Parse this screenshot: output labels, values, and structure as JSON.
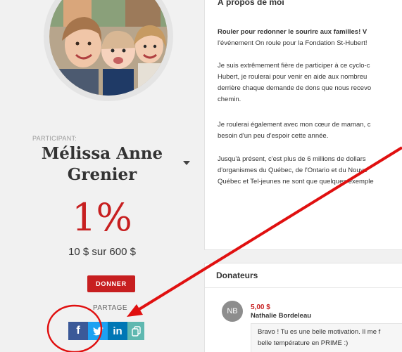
{
  "profile": {
    "participant_label": "PARTICIPANT:",
    "name": "Mélissa Anne Grenier",
    "percent": "1%",
    "amount": "10 $ sur 600 $",
    "donate_label": "DONNER",
    "share_label": "PARTAGE",
    "share_icons": [
      "facebook-icon",
      "twitter-icon",
      "linkedin-icon",
      "copy-icon"
    ],
    "share_glyphs": {
      "facebook": "f",
      "linkedin": "in"
    }
  },
  "about": {
    "title": "À propos de moi",
    "paragraphs": [
      [
        "Rouler pour redonner le sourire aux familles! V",
        "l'événement On roule pour la Fondation St-Hubert!"
      ],
      [
        "Je suis extrêmement fière de participer à ce cyclo-c",
        "Hubert, je roulerai pour venir en aide aux nombreu",
        "derrière chaque demande de dons que nous recevo",
        "chemin."
      ],
      [
        "Je roulerai également avec mon cœur de maman, c",
        "besoin d'un peu d'espoir cette année."
      ],
      [
        "Jusqu'à présent, c'est plus de 6 millions de dollars",
        "d'organismes du Québec, de l'Ontario et du Nouve",
        "Québec et Tel-jeunes ne sont que quelques exemple"
      ]
    ]
  },
  "donors": {
    "title": "Donateurs",
    "items": [
      {
        "initials": "NB",
        "amount": "5,00 $",
        "name": "Nathalie Bordeleau",
        "message": [
          "Bravo ! Tu es une belle motivation. Il me f",
          "belle température en PRIME :)"
        ]
      }
    ]
  },
  "colors": {
    "accent": "#c71f20",
    "facebook": "#3b5998",
    "twitter": "#1da1f2",
    "linkedin": "#0077b5",
    "copy": "#5fb8b0",
    "annotation": "#e01010"
  }
}
